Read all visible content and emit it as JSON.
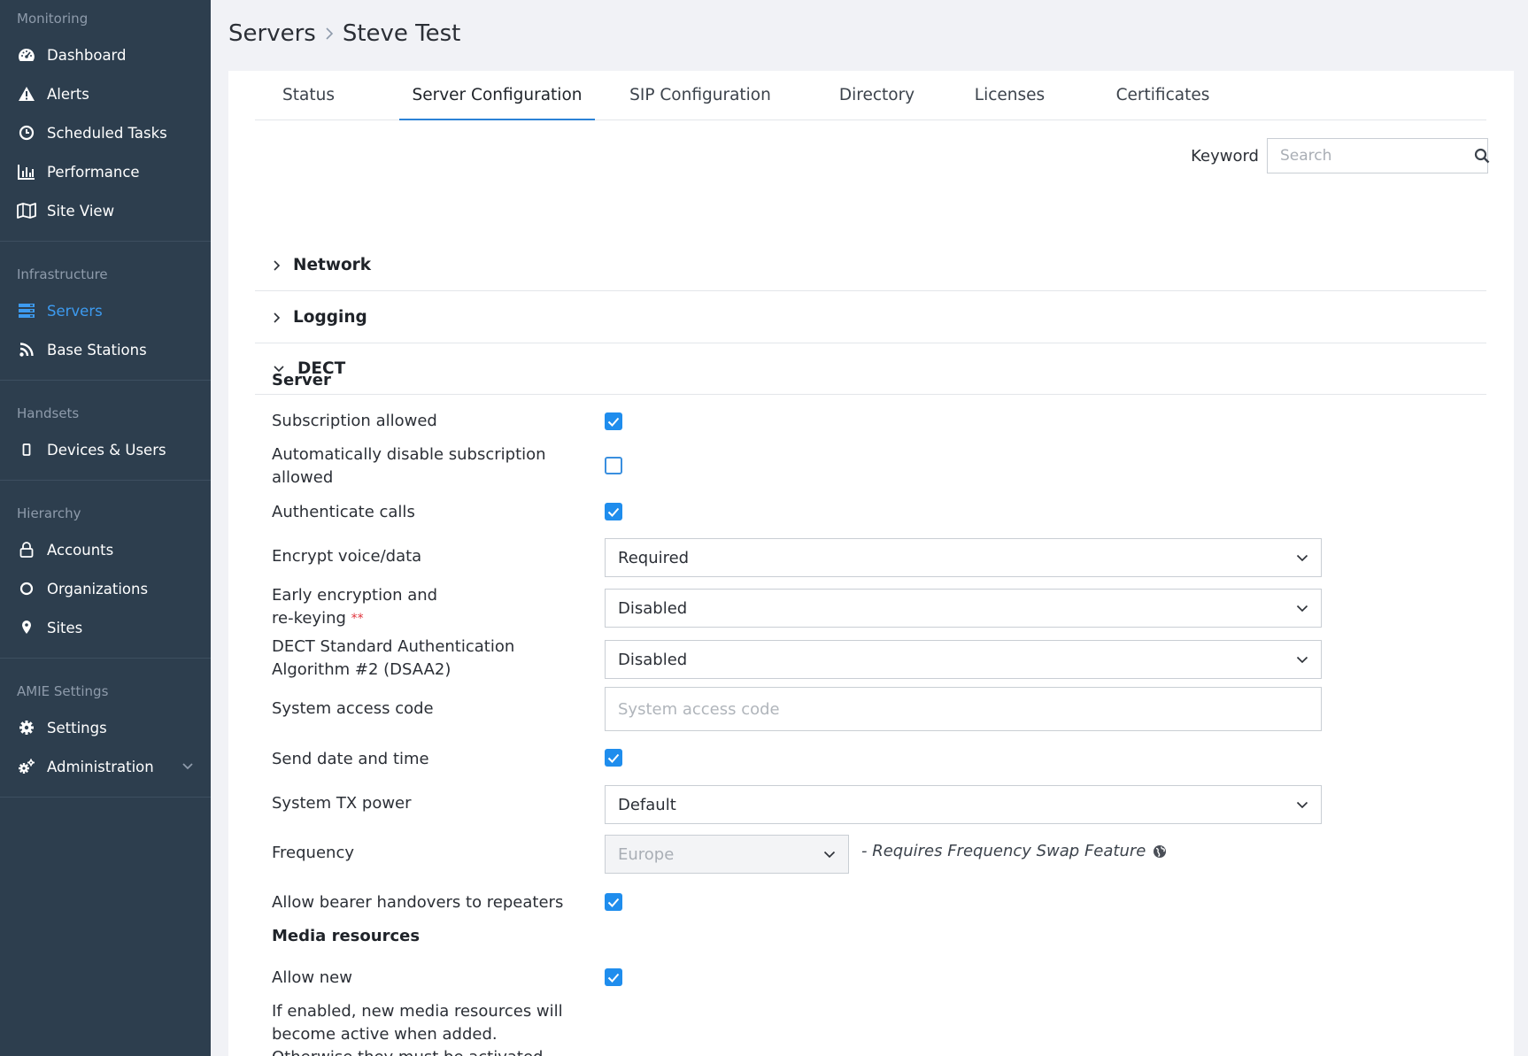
{
  "sidebar": {
    "sections": [
      {
        "heading": "Monitoring",
        "items": [
          {
            "label": "Dashboard",
            "icon": "dashboard-icon"
          },
          {
            "label": "Alerts",
            "icon": "warning-icon"
          },
          {
            "label": "Scheduled Tasks",
            "icon": "clock-icon"
          },
          {
            "label": "Performance",
            "icon": "bar-chart-icon"
          },
          {
            "label": "Site View",
            "icon": "map-icon"
          }
        ]
      },
      {
        "heading": "Infrastructure",
        "items": [
          {
            "label": "Servers",
            "icon": "server-icon",
            "active": true
          },
          {
            "label": "Base Stations",
            "icon": "rss-icon"
          }
        ]
      },
      {
        "heading": "Handsets",
        "items": [
          {
            "label": "Devices & Users",
            "icon": "mobile-icon"
          }
        ]
      },
      {
        "heading": "Hierarchy",
        "items": [
          {
            "label": "Accounts",
            "icon": "lock-icon"
          },
          {
            "label": "Organizations",
            "icon": "circle-icon"
          },
          {
            "label": "Sites",
            "icon": "map-pin-icon"
          }
        ]
      },
      {
        "heading": "AMIE Settings",
        "items": [
          {
            "label": "Settings",
            "icon": "gear-icon"
          },
          {
            "label": "Administration",
            "icon": "gears-icon",
            "expandable": true
          }
        ]
      }
    ]
  },
  "breadcrumb": {
    "parent": "Servers",
    "current": "Steve Test"
  },
  "tabs": [
    {
      "label": "Status"
    },
    {
      "label": "Server Configuration",
      "active": true
    },
    {
      "label": "SIP Configuration"
    },
    {
      "label": "Directory"
    },
    {
      "label": "Licenses"
    },
    {
      "label": "Certificates"
    }
  ],
  "search": {
    "label": "Keyword",
    "placeholder": "Search",
    "value": ""
  },
  "accordions": [
    {
      "label": "Network",
      "expanded": false
    },
    {
      "label": "Logging",
      "expanded": false
    },
    {
      "label": "DECT",
      "expanded": true
    }
  ],
  "dect": {
    "server_heading": "Server",
    "subscription_allowed": {
      "label": "Subscription allowed",
      "checked": true
    },
    "auto_disable_subscription": {
      "label": "Automatically disable subscription allowed",
      "checked": false
    },
    "authenticate_calls": {
      "label": "Authenticate calls",
      "checked": true
    },
    "encrypt_voice": {
      "label": "Encrypt voice/data",
      "value": "Required"
    },
    "early_encryption": {
      "label_line1": "Early encryption and",
      "label_line2": "re-keying",
      "required_marker": "**",
      "value": "Disabled"
    },
    "dsaa2": {
      "label": "DECT Standard Authentication Algorithm #2 (DSAA2)",
      "value": "Disabled"
    },
    "system_access_code": {
      "label": "System access code",
      "placeholder": "System access code",
      "value": ""
    },
    "send_date_time": {
      "label": "Send date and time",
      "checked": true
    },
    "system_tx_power": {
      "label": "System TX power",
      "value": "Default"
    },
    "frequency": {
      "label": "Frequency",
      "value": "Europe",
      "note": "- Requires Frequency Swap Feature"
    },
    "bearer_handovers": {
      "label": "Allow bearer handovers to repeaters",
      "checked": true
    },
    "media_heading": "Media resources",
    "allow_new": {
      "label": "Allow new",
      "checked": true
    },
    "allow_new_help": "If enabled, new media resources will become active when added. Otherwise they must be activated manually under"
  },
  "colors": {
    "sidebar_bg": "#2d3e4e",
    "accent": "#1f8ded",
    "active_nav": "#3d9bf0",
    "required": "#e0333c"
  }
}
